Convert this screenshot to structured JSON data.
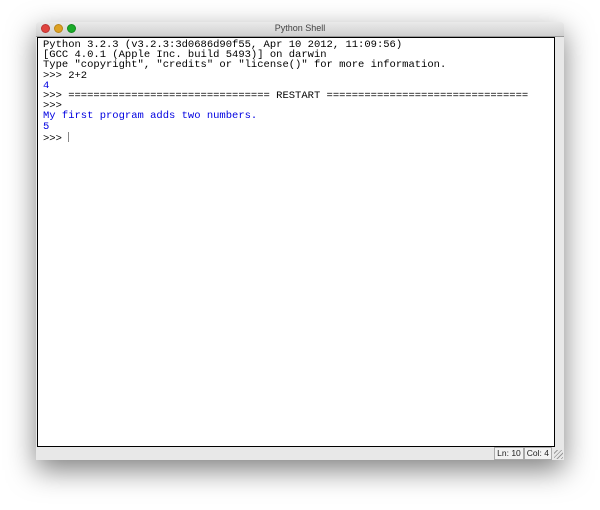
{
  "window": {
    "title": "Python Shell"
  },
  "shell": {
    "lines": [
      {
        "text": "Python 3.2.3 (v3.2.3:3d0686d90f55, Apr 10 2012, 11:09:56)",
        "kind": "stdout"
      },
      {
        "text": "[GCC 4.0.1 (Apple Inc. build 5493)] on darwin",
        "kind": "stdout"
      },
      {
        "text": "Type \"copyright\", \"credits\" or \"license()\" for more information.",
        "kind": "stdout"
      },
      {
        "text": ">>> 2+2",
        "kind": "input"
      },
      {
        "text": "4",
        "kind": "output"
      },
      {
        "text": ">>> ================================ RESTART ================================",
        "kind": "input"
      },
      {
        "text": ">>> ",
        "kind": "input"
      },
      {
        "text": "My first program adds two numbers.",
        "kind": "output"
      },
      {
        "text": "5",
        "kind": "output"
      }
    ],
    "prompt": ">>> "
  },
  "status": {
    "line": "Ln: 10",
    "col": "Col: 4"
  }
}
